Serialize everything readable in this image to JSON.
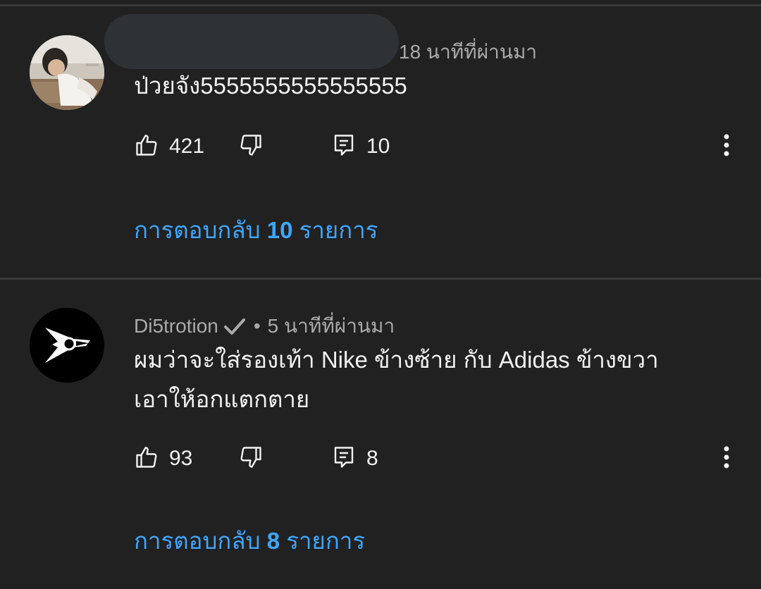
{
  "comments": [
    {
      "author": "",
      "time": "18 นาทีที่ผ่านมา",
      "text": "ป่วยจัง5555555555555555",
      "likes": "421",
      "reply_count": "10",
      "replies_prefix": "การตอบกลับ",
      "replies_number": "10",
      "replies_suffix": "รายการ",
      "avatar_icon": "user-photo-avatar"
    },
    {
      "author": "Di5trotion",
      "verified_icon": "checkmark-icon",
      "separator": "•",
      "time": "5 นาทีที่ผ่านมา",
      "text": "ผมว่าจะใส่รองเท้า Nike ข้างซ้าย กับ Adidas ข้างขวา\nเอาให้อกแตกตาย",
      "likes": "93",
      "reply_count": "8",
      "replies_prefix": "การตอบกลับ",
      "replies_number": "8",
      "replies_suffix": "รายการ",
      "avatar_icon": "logo-avatar"
    }
  ],
  "colors": {
    "background": "#212121",
    "text": "#f1f1f1",
    "meta": "#aaaaaa",
    "link": "#3ea6ff",
    "redaction": "#2e3236"
  },
  "icons": [
    "thumbs-up-icon",
    "thumbs-down-icon",
    "reply-icon",
    "more-vert-icon"
  ]
}
